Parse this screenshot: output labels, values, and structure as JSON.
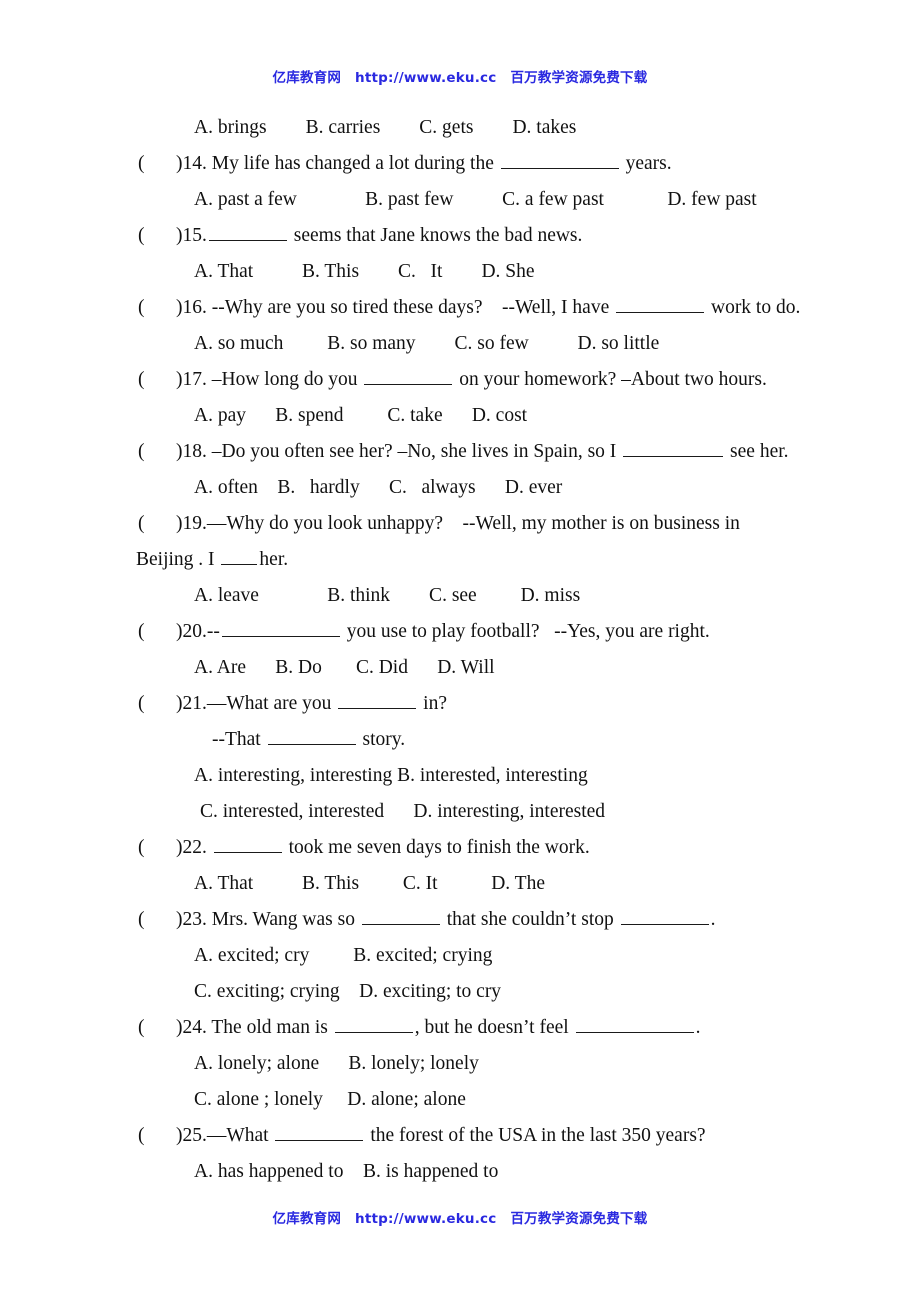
{
  "watermark": {
    "site_name": "亿库教育网",
    "url": "http://www.eku.cc",
    "tagline": "百万教学资源免费下载",
    "color": "#2a29e0"
  },
  "document": {
    "type": "English multiple-choice worksheet",
    "first_visible_options_line": "A. brings        B. carries        C. gets        D. takes"
  },
  "questions": [
    {
      "number": "14",
      "stem_prefix": ")14. My life has changed a lot during the ",
      "stem_suffix": " years.",
      "options_lines": [
        "A. past a few              B. past few          C. a few past             D. few past"
      ]
    },
    {
      "number": "15",
      "stem_prefix": ")15.",
      "stem_suffix": " seems that Jane knows the bad news.",
      "options_lines": [
        "A. That          B. This        C.   It        D. She"
      ]
    },
    {
      "number": "16",
      "stem_prefix": ")16. --Why are you so tired these days?    --Well, I have ",
      "stem_suffix": " work to do.",
      "options_lines": [
        "A. so much         B. so many        C. so few          D. so little"
      ]
    },
    {
      "number": "17",
      "stem_prefix": ")17. –How long do you ",
      "stem_suffix": " on your homework? –About two hours.",
      "options_lines": [
        "A. pay      B. spend         C. take      D. cost"
      ]
    },
    {
      "number": "18",
      "stem_prefix": ")18. –Do you often see her? –No, she lives in Spain, so I ",
      "stem_suffix": " see her.",
      "options_lines": [
        "A. often    B.   hardly      C.   always      D. ever"
      ]
    },
    {
      "number": "19",
      "stem_prefix": ")19.—Why do you look unhappy?    --Well, my mother is on business in",
      "stem_suffix": "",
      "continuation_prefix": "Beijing . I ",
      "continuation_suffix": "her.",
      "options_lines": [
        "A. leave              B. think        C. see         D. miss"
      ]
    },
    {
      "number": "20",
      "stem_prefix": ")20.--",
      "stem_suffix": " you use to play football?   --Yes, you are right.",
      "options_lines": [
        "A. Are      B. Do       C. Did      D. Will"
      ]
    },
    {
      "number": "21",
      "stem_prefix": ")21.—What are you ",
      "stem_suffix": " in?",
      "continuation_prefix": "--That ",
      "continuation_suffix": " story.",
      "options_lines": [
        "A. interesting, interesting B. interested, interesting",
        "C. interested, interested      D. interesting, interested"
      ]
    },
    {
      "number": "22",
      "stem_prefix": ")22. ",
      "stem_suffix": " took me seven days to finish the work.",
      "options_lines": [
        "A. That          B. This         C. It           D. The"
      ]
    },
    {
      "number": "23",
      "stem_prefix": ")23. Mrs. Wang was so ",
      "stem_mid": " that she couldn’t stop ",
      "stem_suffix": ".",
      "options_lines": [
        "A. excited; cry         B. excited; crying",
        "C. exciting; crying    D. exciting; to cry"
      ]
    },
    {
      "number": "24",
      "stem_prefix": ")24. The old man is ",
      "stem_mid": ", but he doesn’t feel ",
      "stem_suffix": ".",
      "options_lines": [
        "A. lonely; alone      B. lonely; lonely",
        "C. alone ; lonely     D. alone; alone"
      ]
    },
    {
      "number": "25",
      "stem_prefix": ")25.—What ",
      "stem_suffix": " the forest of the USA in the last 350 years?",
      "options_lines": [
        "A. has happened to    B. is happened to"
      ]
    }
  ]
}
